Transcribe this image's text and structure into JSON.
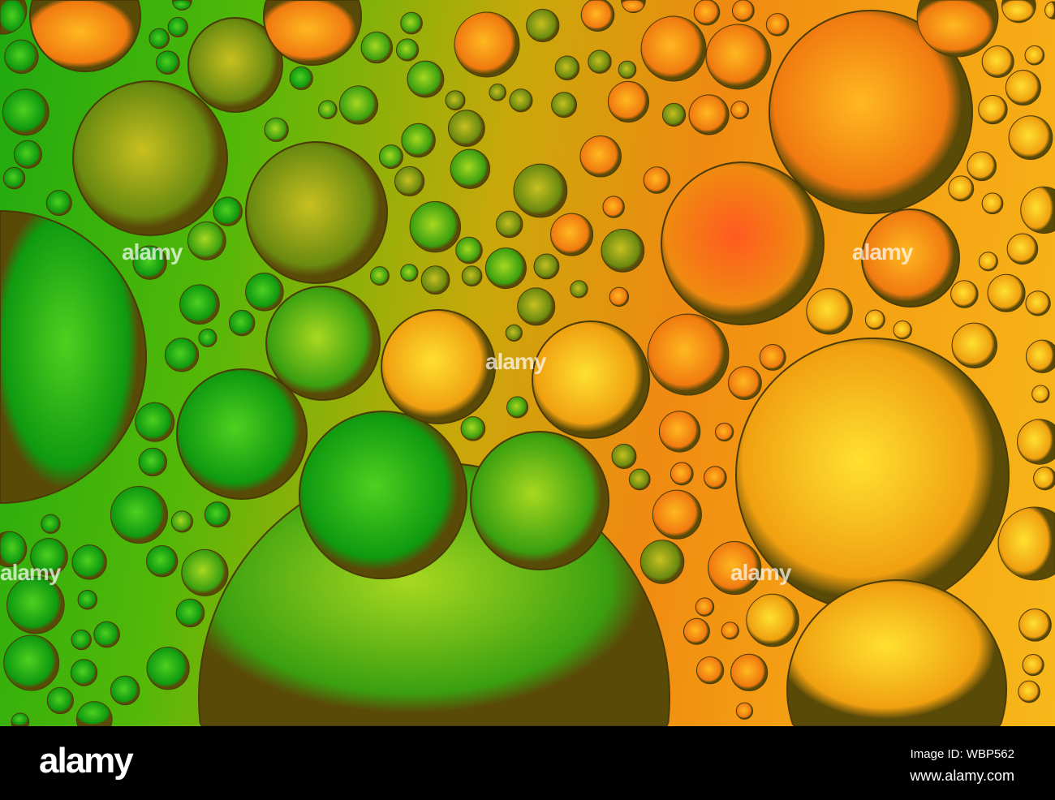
{
  "photo": {
    "subject": "oil bubbles on water",
    "colors": {
      "green": "#1faa10",
      "yellow": "#f7d21a",
      "orange": "#f08a12",
      "red": "#f0501a"
    }
  },
  "watermark": {
    "logo": "alamy",
    "image_id": "Image ID: WBP562",
    "website": "www.alamy.com"
  }
}
